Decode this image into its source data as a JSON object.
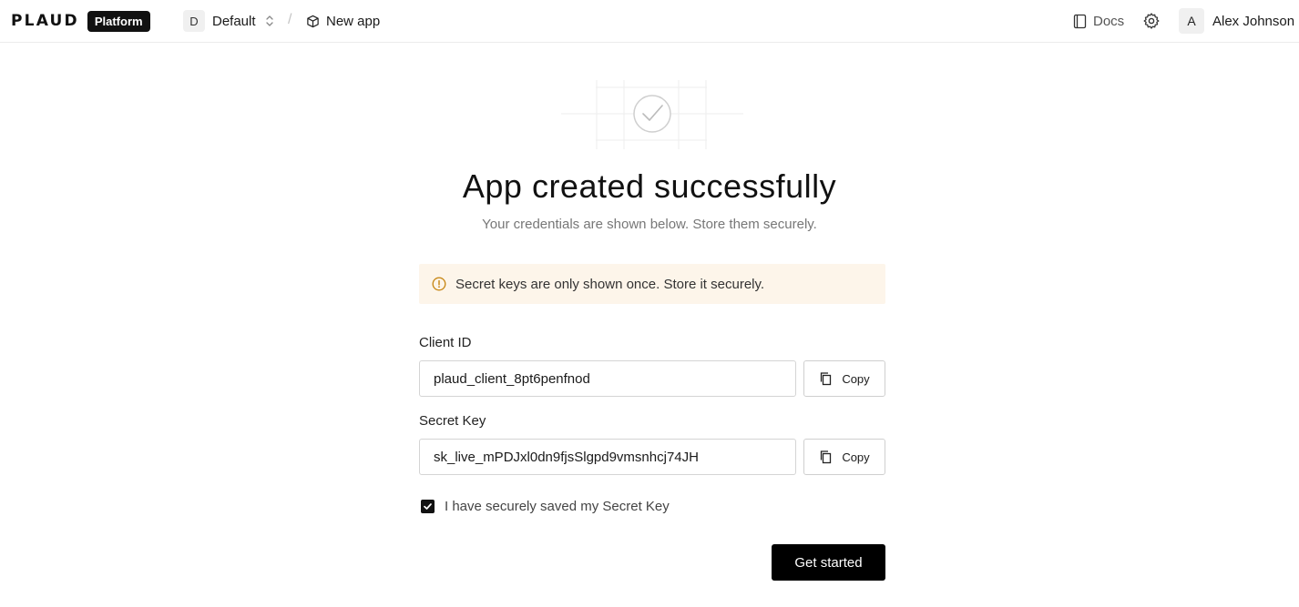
{
  "header": {
    "logo_text": "PLAUD",
    "platform_badge": "Platform",
    "workspace": {
      "avatar_letter": "D",
      "name": "Default"
    },
    "breadcrumb_separator": "/",
    "app_crumb": "New app",
    "docs_label": "Docs",
    "user": {
      "avatar_letter": "A",
      "name": "Alex Johnson"
    }
  },
  "main": {
    "title": "App created successfully",
    "subtitle": "Your credentials are shown below. Store them securely.",
    "warning": "Secret keys are only shown once. Store it securely.",
    "client_id": {
      "label": "Client ID",
      "value": "plaud_client_8pt6penfnod",
      "copy_label": "Copy"
    },
    "secret_key": {
      "label": "Secret Key",
      "value": "sk_live_mPDJxl0dn9fjsSlgpd9vmsnhcj74JH",
      "copy_label": "Copy"
    },
    "confirm_checkbox": {
      "label": "I have securely saved my Secret Key",
      "checked": true
    },
    "primary_button": "Get started"
  },
  "colors": {
    "primary": "#000000",
    "warning_bg": "#fdf5ea",
    "warning_icon": "#c98a1b",
    "muted_text": "#777777"
  },
  "icons": [
    "selector-chevrons-icon",
    "cube-icon",
    "book-icon",
    "gear-icon",
    "alert-circle-icon",
    "copy-icon",
    "check-icon",
    "success-check-icon"
  ]
}
